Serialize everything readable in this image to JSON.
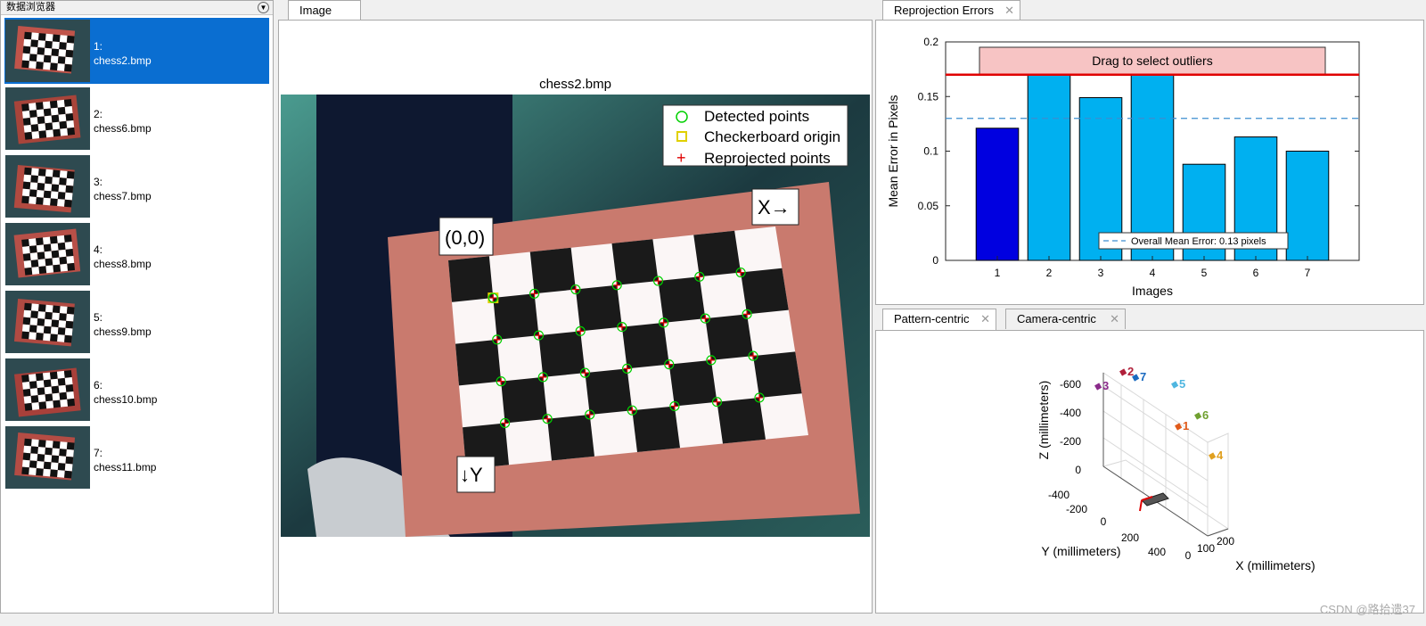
{
  "browser": {
    "title": "数据浏览器",
    "items": [
      {
        "index": "1:",
        "file": "chess2.bmp",
        "selected": true
      },
      {
        "index": "2:",
        "file": "chess6.bmp"
      },
      {
        "index": "3:",
        "file": "chess7.bmp"
      },
      {
        "index": "4:",
        "file": "chess8.bmp"
      },
      {
        "index": "5:",
        "file": "chess9.bmp"
      },
      {
        "index": "6:",
        "file": "chess10.bmp"
      },
      {
        "index": "7:",
        "file": "chess11.bmp"
      }
    ]
  },
  "image_panel": {
    "tab": "Image",
    "title": "chess2.bmp",
    "legend": [
      "Detected points",
      "Checkerboard origin",
      "Reprojected points"
    ],
    "origin_label": "(0,0)",
    "x_label": "X→",
    "y_label": "↓Y"
  },
  "reprojection_panel": {
    "tab": "Reprojection Errors"
  },
  "pattern_panel": {
    "tabs": [
      "Pattern-centric",
      "Camera-centric"
    ],
    "zlabel": "Z (millimeters)",
    "ylabel": "Y (millimeters)",
    "xlabel": "X (millimeters)",
    "z_ticks": [
      "-600",
      "-400",
      "-200",
      "0"
    ],
    "y_ticks": [
      "-400",
      "-200",
      "0",
      "200",
      "400"
    ],
    "x_ticks": [
      "0",
      "100",
      "200"
    ],
    "cameras": [
      {
        "label": "1",
        "color": "#e05a1a"
      },
      {
        "label": "2",
        "color": "#b0203a"
      },
      {
        "label": "3",
        "color": "#8a2a8a"
      },
      {
        "label": "4",
        "color": "#e0a020"
      },
      {
        "label": "5",
        "color": "#4fb6e0"
      },
      {
        "label": "6",
        "color": "#70a030"
      },
      {
        "label": "7",
        "color": "#1a6ac0"
      }
    ]
  },
  "chart_data": {
    "type": "bar",
    "categories": [
      "1",
      "2",
      "3",
      "4",
      "5",
      "6",
      "7"
    ],
    "values": [
      0.121,
      0.172,
      0.149,
      0.172,
      0.088,
      0.113,
      0.1
    ],
    "selected_index": 0,
    "xlabel": "Images",
    "ylabel": "Mean Error in Pixels",
    "ylim": [
      0,
      0.2
    ],
    "yticks": [
      "0",
      "0.05",
      "0.1",
      "0.15",
      "0.2"
    ],
    "mean_error": 0.13,
    "mean_label": "Overall Mean Error: 0.13 pixels",
    "threshold": 0.17,
    "drag_label": "Drag to select outliers",
    "colors": {
      "bar": "#00b0f0",
      "selected": "#0000e0",
      "threshold": "#e00000",
      "mean": "#3c8ed0"
    }
  },
  "footer": "CSDN @路拾遗37"
}
